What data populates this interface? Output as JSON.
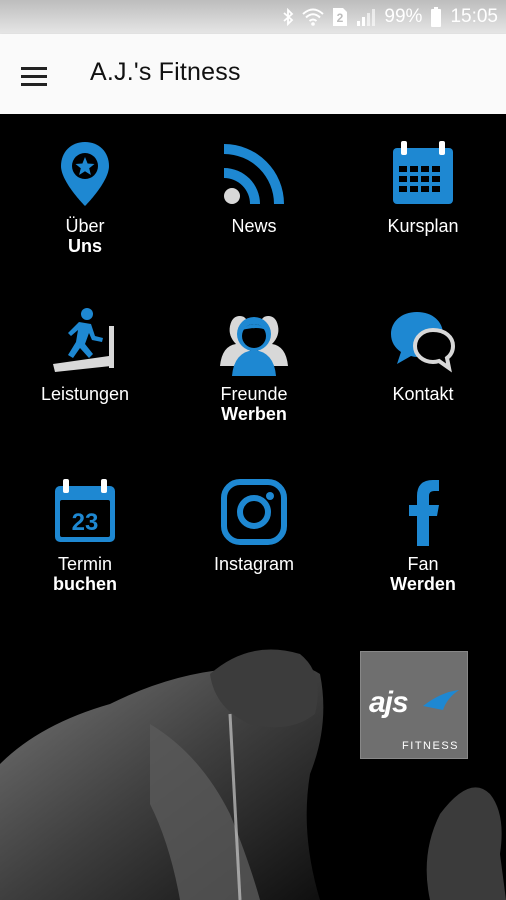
{
  "status": {
    "battery": "99%",
    "time": "15:05",
    "sim_slot": "2"
  },
  "appbar": {
    "title": "A.J.'s Fitness"
  },
  "accent": "#1e88d2",
  "tiles": [
    {
      "id": "ueber-uns",
      "icon": "map-pin-star-icon",
      "line1": "Über",
      "line2": "Uns"
    },
    {
      "id": "news",
      "icon": "rss-icon",
      "line1": "News",
      "line2": ""
    },
    {
      "id": "kursplan",
      "icon": "calendar-grid-icon",
      "line1": "Kursplan",
      "line2": ""
    },
    {
      "id": "leistungen",
      "icon": "treadmill-icon",
      "line1": "Leistungen",
      "line2": ""
    },
    {
      "id": "freunde-werben",
      "icon": "friends-icon",
      "line1": "Freunde",
      "line2": "Werben"
    },
    {
      "id": "kontakt",
      "icon": "chat-bubbles-icon",
      "line1": "Kontakt",
      "line2": ""
    },
    {
      "id": "termin-buchen",
      "icon": "calendar-23-icon",
      "line1": "Termin",
      "line2": "buchen",
      "calendar_day": "23"
    },
    {
      "id": "instagram",
      "icon": "instagram-icon",
      "line1": "Instagram",
      "line2": ""
    },
    {
      "id": "fan-werden",
      "icon": "facebook-icon",
      "line1": "Fan",
      "line2": "Werden"
    }
  ],
  "logo": {
    "text": "ajs",
    "subtitle": "FITNESS"
  }
}
